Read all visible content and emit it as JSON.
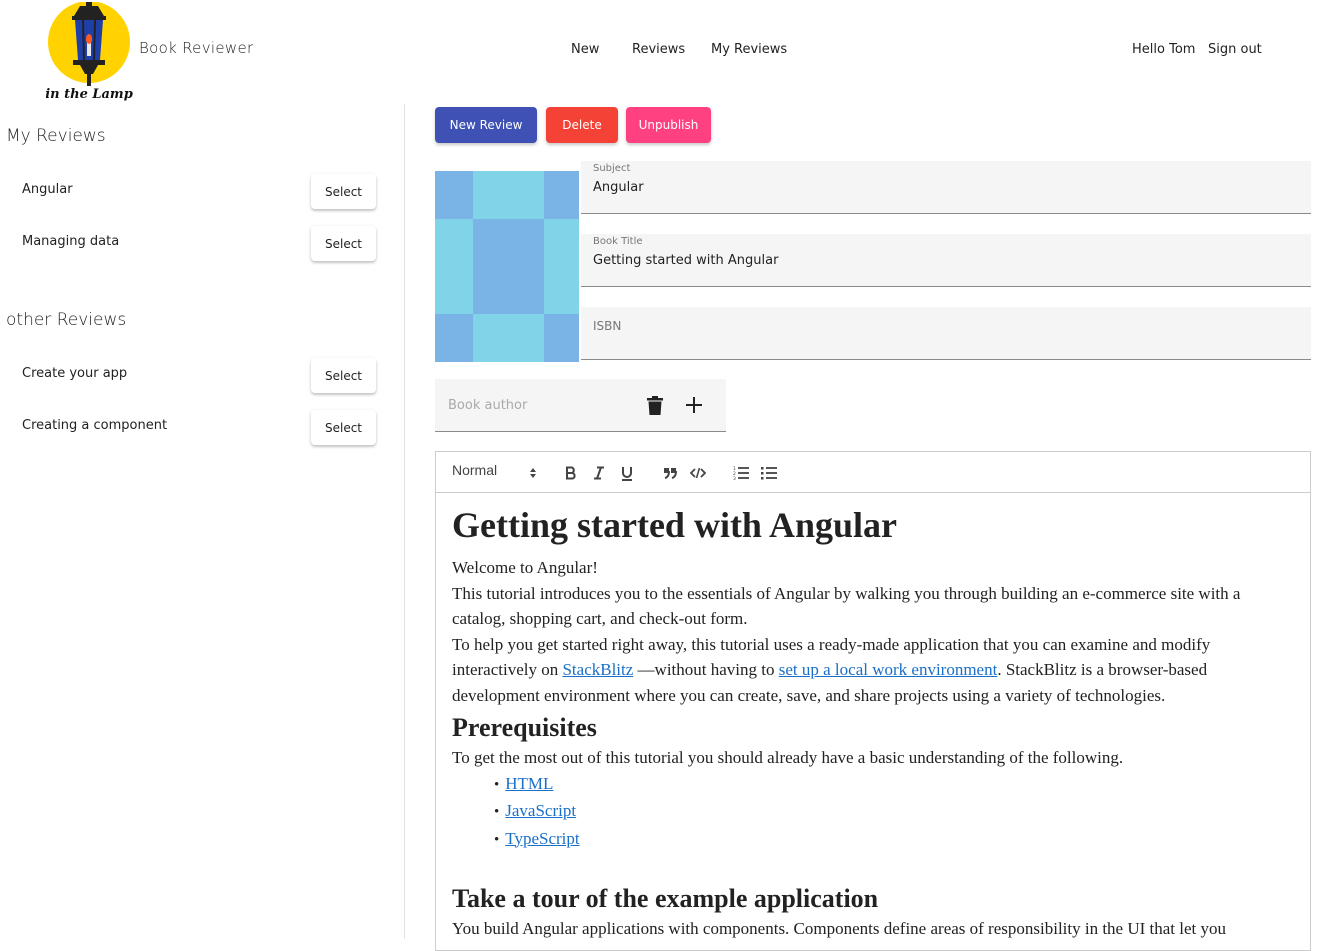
{
  "brand": {
    "name": "Book Reviewer",
    "logo_caption": "in the Lamp"
  },
  "nav": {
    "new": "New",
    "reviews": "Reviews",
    "my_reviews": "My Reviews",
    "hello": "Hello Tom",
    "sign_out": "Sign out"
  },
  "sidebar": {
    "my_reviews_title": "My Reviews",
    "my_reviews": [
      {
        "label": "Angular",
        "button": "Select"
      },
      {
        "label": "Managing data",
        "button": "Select"
      }
    ],
    "other_reviews_title": "other Reviews",
    "other_reviews": [
      {
        "label": "Create your app",
        "button": "Select"
      },
      {
        "label": "Creating a component",
        "button": "Select"
      }
    ]
  },
  "actions": {
    "new_review": "New Review",
    "delete": "Delete",
    "unpublish": "Unpublish"
  },
  "form": {
    "subject_label": "Subject",
    "subject_value": "Angular",
    "title_label": "Book Title",
    "title_value": "Getting started with Angular",
    "isbn_label": "ISBN",
    "isbn_value": "",
    "author_placeholder": "Book author"
  },
  "colors": {
    "primary": "#3f51b5",
    "warn": "#f44336",
    "accent": "#ff4081",
    "cover_light": "#81d4e8",
    "cover_dark": "#7ab3e6",
    "link": "#1a6fc9"
  },
  "icons": {
    "delete": "trash-icon",
    "add": "plus-icon"
  },
  "editor": {
    "format": "Normal",
    "toolbar": [
      "bold",
      "italic",
      "underline",
      "blockquote",
      "code-block",
      "ordered-list",
      "bullet-list"
    ],
    "content": {
      "h1": "Getting started with Angular",
      "p1": "Welcome to Angular!",
      "p2": "This tutorial introduces you to the essentials of Angular by walking you through building an e-commerce site with a catalog, shopping cart, and check-out form.",
      "p3_a": "To help you get started right away, this tutorial uses a ready-made application that you can examine and modify interactively on ",
      "p3_link1": "StackBlitz",
      "p3_b": " —without having to ",
      "p3_link2": "set up a local work environment",
      "p3_c": ". StackBlitz is a browser-based development environment where you can create, save, and share projects using a variety of technologies.",
      "h2_prereq": "Prerequisites",
      "p4": "To get the most out of this tutorial you should already have a basic understanding of the following.",
      "list": [
        "HTML",
        "JavaScript",
        "TypeScript"
      ],
      "h2_tour": "Take a tour of the example application",
      "p5": "You build Angular applications with components. Components define areas of responsibility in the UI that let you"
    }
  }
}
